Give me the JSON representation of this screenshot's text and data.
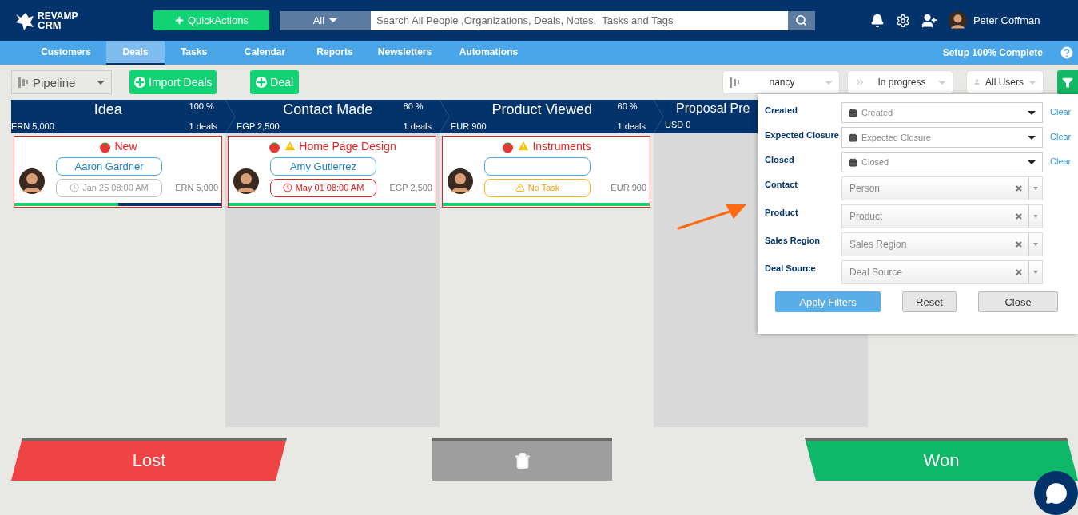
{
  "header": {
    "logo_line1": "REVAMP",
    "logo_line2": "CRM",
    "quick_actions": "QuickActions",
    "search_scope": "All",
    "search_placeholder": "Search All People ,Organizations, Deals, Notes,  Tasks and Tags",
    "user_name": "Peter Coffman"
  },
  "nav": {
    "tabs": [
      {
        "label": "Customers",
        "selected": false
      },
      {
        "label": "Deals",
        "selected": true
      },
      {
        "label": "Tasks",
        "selected": false
      },
      {
        "label": "Calendar",
        "selected": false
      },
      {
        "label": "Reports",
        "selected": false
      },
      {
        "label": "Newsletters",
        "selected": false
      },
      {
        "label": "Automations",
        "selected": false
      }
    ],
    "setup_status": "Setup 100% Complete"
  },
  "toolbar": {
    "view": "Pipeline",
    "import_button": "Import Deals",
    "deal_button": "Deal",
    "filters": [
      {
        "kind": "pipeline",
        "value": "nancy"
      },
      {
        "kind": "status",
        "value": "In progress"
      },
      {
        "kind": "users",
        "value": "All Users"
      }
    ]
  },
  "stages": [
    {
      "name": "Idea",
      "percent": "100 %",
      "amount": "ERN 5,000",
      "count": "1 deals",
      "deals": [
        {
          "title": "New",
          "warning": false,
          "contact": "Aaron Gardner",
          "task": {
            "kind": "scheduled",
            "text": "Jan 25 08:00 AM"
          },
          "amount": "ERN 5,000",
          "level": 0.5
        }
      ]
    },
    {
      "name": "Contact Made",
      "percent": "80 %",
      "amount": "EGP 2,500",
      "count": "1 deals",
      "deals": [
        {
          "title": "Home Page Design",
          "warning": true,
          "contact": "Amy Gutierrez",
          "task": {
            "kind": "overdue",
            "text": "May 01 08:00 AM"
          },
          "amount": "EGP 2,500",
          "level": 1
        }
      ]
    },
    {
      "name": "Product Viewed",
      "percent": "60 %",
      "amount": "EUR 900",
      "count": "1 deals",
      "deals": [
        {
          "title": "Instruments",
          "warning": true,
          "task": {
            "kind": "none",
            "text": "No Task"
          },
          "amount": "EUR 900",
          "level": 1
        }
      ]
    },
    {
      "name": "Proposal Pre",
      "amount": "USD 0"
    }
  ],
  "filter_panel": {
    "rows": [
      {
        "kind": "date",
        "label": "Created",
        "placeholder": "Created",
        "clear": "Clear"
      },
      {
        "kind": "date",
        "label": "Expected Closure",
        "placeholder": "Expected Closure",
        "clear": "Clear"
      },
      {
        "kind": "date",
        "label": "Closed",
        "placeholder": "Closed",
        "clear": "Clear"
      },
      {
        "kind": "select",
        "label": "Contact",
        "placeholder": "Person"
      },
      {
        "kind": "select",
        "label": "Product",
        "placeholder": "Product"
      },
      {
        "kind": "select",
        "label": "Sales Region",
        "placeholder": "Sales Region"
      },
      {
        "kind": "select",
        "label": "Deal Source",
        "placeholder": "Deal Source"
      }
    ],
    "buttons": [
      {
        "kind": "primary",
        "label": "Apply Filters"
      },
      {
        "kind": "default",
        "label": "Reset"
      },
      {
        "kind": "default",
        "label": "Close"
      }
    ]
  },
  "drop_zones": {
    "lost": "Lost",
    "won": "Won"
  }
}
